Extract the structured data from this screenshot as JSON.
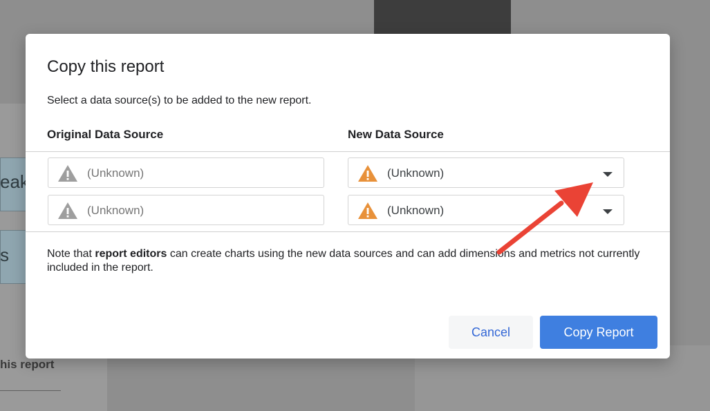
{
  "background": {
    "card_texts": [
      "eak",
      "s"
    ],
    "report_label": "his report"
  },
  "dialog": {
    "title": "Copy this report",
    "description": "Select a data source(s) to be added to the new report.",
    "columns": {
      "original": "Original Data Source",
      "new": "New Data Source"
    },
    "rows": [
      {
        "original": "(Unknown)",
        "new": "(Unknown)"
      },
      {
        "original": "(Unknown)",
        "new": "(Unknown)"
      }
    ],
    "note": {
      "prefix": "Note that ",
      "bold": "report editors",
      "suffix": " can create charts using the new data sources and can add dimensions and metrics not currently included in the report."
    },
    "buttons": {
      "cancel": "Cancel",
      "copy": "Copy Report"
    }
  },
  "colors": {
    "warning_gray": "#9e9e9e",
    "warning_orange": "#e8913a",
    "primary": "#3f7fe0",
    "annotation_arrow": "#ea4335"
  },
  "icons": {
    "warning": "warning-triangle-icon",
    "dropdown": "chevron-down-icon"
  }
}
